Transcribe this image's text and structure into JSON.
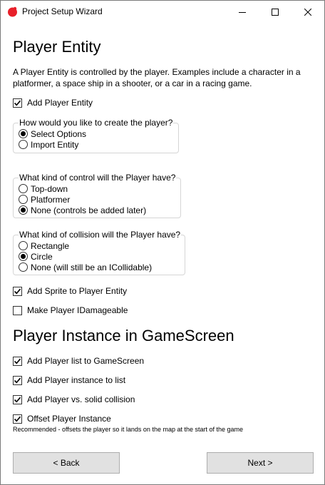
{
  "window": {
    "title": "Project Setup Wizard",
    "icon": "red-app-icon",
    "controls": [
      "minimize-icon",
      "maximize-icon",
      "close-icon"
    ]
  },
  "section1": {
    "heading": "Player Entity",
    "description": "A Player Entity is controlled by the player. Examples include a character in a platformer, a space ship in a shooter, or a car in a racing game.",
    "add_player_entity": {
      "label": "Add Player Entity",
      "checked": true
    }
  },
  "create_group": {
    "label": "How would you like to create the player?",
    "options": [
      {
        "label": "Select Options",
        "selected": true
      },
      {
        "label": "Import Entity",
        "selected": false
      }
    ]
  },
  "control_group": {
    "label": "What kind of control will the Player have?",
    "options": [
      {
        "label": "Top-down",
        "selected": false
      },
      {
        "label": "Platformer",
        "selected": false
      },
      {
        "label": "None (controls be added later)",
        "selected": true
      }
    ]
  },
  "collision_group": {
    "label": "What kind of collision will the Player have?",
    "options": [
      {
        "label": "Rectangle",
        "selected": false
      },
      {
        "label": "Circle",
        "selected": true
      },
      {
        "label": "None (will still be an ICollidable)",
        "selected": false
      }
    ]
  },
  "options": {
    "add_sprite": {
      "label": "Add Sprite to Player Entity",
      "checked": true
    },
    "damageable": {
      "label": "Make Player IDamageable",
      "checked": false
    }
  },
  "section2": {
    "heading": "Player Instance in GameScreen",
    "add_list": {
      "label": "Add Player list to GameScreen",
      "checked": true
    },
    "add_instance": {
      "label": "Add Player instance to list",
      "checked": true
    },
    "add_collision": {
      "label": "Add Player vs. solid collision",
      "checked": true
    },
    "offset": {
      "label": "Offset Player Instance",
      "checked": true
    },
    "offset_note": "Recommended - offsets the player so it lands on the map at the start of the game"
  },
  "buttons": {
    "back": "< Back",
    "next": "Next >"
  }
}
